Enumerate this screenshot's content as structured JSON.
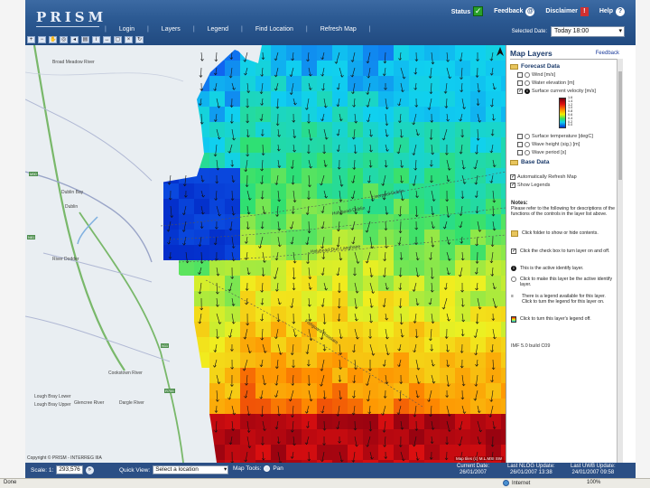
{
  "app": {
    "logo": "PRISM",
    "nav": [
      "Login",
      "Layers",
      "Legend",
      "Find Location",
      "Refresh Map"
    ],
    "status_label": "Status",
    "feedback_label": "Feedback",
    "disclaimer_label": "Disclaimer",
    "help_label": "Help",
    "selected_date_label": "Selected Date:",
    "selected_date_value": "Today 18:00"
  },
  "map": {
    "places": [
      {
        "name": "Broad Meadow River"
      },
      {
        "name": "Dublin Bay"
      },
      {
        "name": "Dublin"
      },
      {
        "name": "River Dodder"
      },
      {
        "name": "Cookstown River"
      },
      {
        "name": "Lough Bray Lower"
      },
      {
        "name": "Lough Bray Upper"
      },
      {
        "name": "Glencree River"
      },
      {
        "name": "Dargle River"
      }
    ],
    "sea_labels": [
      "Liverpool-Dublin",
      "Holyhead-Dublin",
      "Holyhead-Dun Laoghaire",
      "Fishguard-Rosslare"
    ],
    "copyright": "Copyright © PRISM - INTERREG IIIA",
    "credit": "Map tiles (c) M.L.MSI SW",
    "colors": {
      "deep_blue": "#0020c0",
      "blue": "#1060f0",
      "cyan": "#10d0f0",
      "green": "#30e070",
      "yellow": "#f0f020",
      "orange": "#ff9000",
      "red": "#e01010",
      "dark_red": "#8a0010",
      "land": "#e9eef2"
    }
  },
  "panel": {
    "title": "Map Layers",
    "feedback": "Feedback",
    "forecast_folder": "Forecast Data",
    "layers": [
      {
        "label": "Wind [m/s]",
        "checked": false
      },
      {
        "label": "Water elevation [m]",
        "checked": false
      },
      {
        "label": "Surface current velocity [m/s]",
        "checked": true
      },
      {
        "label": "Surface temperature [degC]",
        "checked": false
      },
      {
        "label": "Wave height (sig.) [m]",
        "checked": false
      },
      {
        "label": "Wave period [s]",
        "checked": false
      }
    ],
    "base_folder": "Base Data",
    "options": [
      {
        "label": "Automatically Refresh Map",
        "checked": true
      },
      {
        "label": "Show Legends",
        "checked": true
      }
    ],
    "notes_title": "Notes:",
    "notes_intro": "Please refer to the following for descriptions of the functions of the controls in the layer list above.",
    "notes": [
      "Click folder to show or hide contents.",
      "Click the check box to turn layer on and off.",
      "This is the active identify layer.",
      "Click to make this layer be the active identify layer.",
      "There is a legend available for this layer. Click to turn the legend for this layer on.",
      "Click to turn this layer's legend off."
    ],
    "version": "IMF 5.0 build C09"
  },
  "bottom": {
    "scale_label": "Scale: 1:",
    "scale_value": "293,576",
    "quick_view_label": "Quick View:",
    "quick_view_value": "Select a location",
    "map_tools_label": "Map Tools:",
    "pan_label": "Pan",
    "current_date_label": "Current Date:",
    "current_date_value": "26/01/2007",
    "last_nlog_label": "Last NLOG Update:",
    "last_nlog_value": "26/01/2007 13:38",
    "last_uwb_label": "Last UWB Update:",
    "last_uwb_value": "24/01/2007 09:58"
  },
  "browser": {
    "status": "Done",
    "zone": "Internet",
    "zoom": "100%"
  }
}
